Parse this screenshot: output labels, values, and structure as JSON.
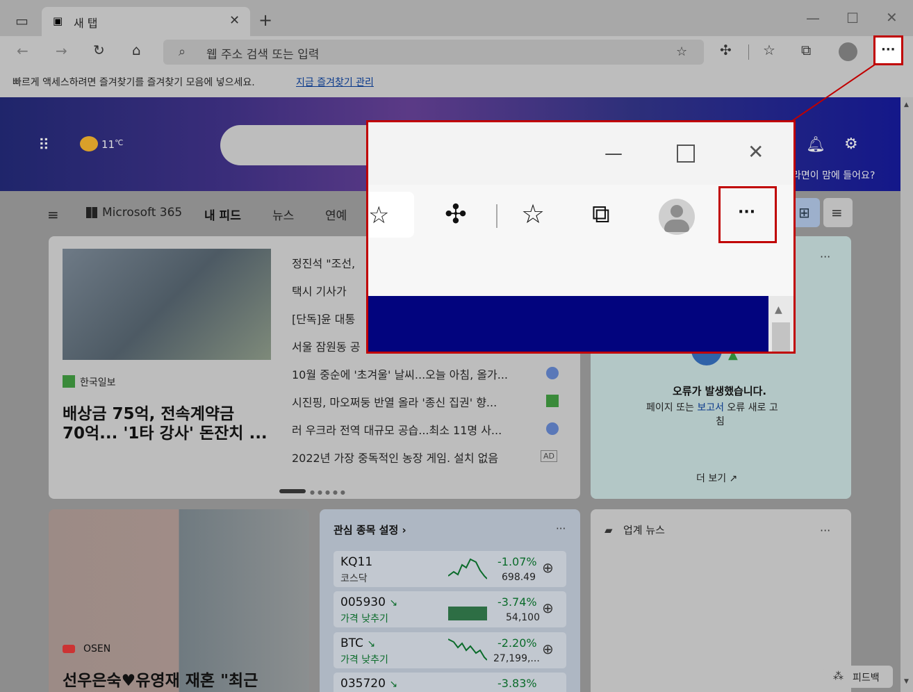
{
  "tab": {
    "title": "새 탭"
  },
  "address": {
    "placeholder": "웹 주소 검색 또는 입력"
  },
  "favbar": {
    "text": "빠르게 액세스하려면 즐겨찾기를 즐겨찾기 모음에 넣으세요.",
    "link": "지금 즐겨찾기 관리"
  },
  "weather": {
    "temp": "11",
    "unit": "℃"
  },
  "hero": {
    "question": "라면이 맘에 들어요?"
  },
  "nav": {
    "ms365": "Microsoft 365",
    "feed": "내 피드",
    "news": "뉴스",
    "ent": "연예"
  },
  "headlines": [
    "정진석 \"조선,",
    "택시 기사가 ",
    "[단독]윤 대통",
    "서울 잠원동 공",
    "10월 중순에 '초겨울' 날씨...오늘 아침, 올가...",
    "시진핑, 마오쩌둥 반열 올라 '종신 집권' 향...",
    "러 우크라 전역 대규모 공습...최소 11명 사...",
    "2022년 가장 중독적인 농장 게임. 설치 없음"
  ],
  "ad": "AD",
  "main_story": {
    "source": "한국일보",
    "title1": "배상금 75억, 전속계약금",
    "title2": "70억... '1타 강사' 돈잔치 ..."
  },
  "error_card": {
    "title": "오류가 발생했습니다.",
    "line1": "페이지 또는 ",
    "link": "보고서",
    "line1b": " 오류 새로 고",
    "line2": "침",
    "more": "더 보기"
  },
  "photo_story": {
    "source": "OSEN",
    "title": "선우은숙♥유영재 재혼 \"최근"
  },
  "stocks": {
    "header": "관심 종목 설정",
    "items": [
      {
        "sym": "KQ11",
        "sub": "코스닥",
        "change": "-1.07%",
        "price": "698.49"
      },
      {
        "sym": "005930",
        "sub": "가격 낮추기",
        "change": "-3.74%",
        "price": "54,100"
      },
      {
        "sym": "BTC",
        "sub": "가격 낮추기",
        "change": "-2.20%",
        "price": "27,199,..."
      },
      {
        "sym": "035720",
        "sub": "",
        "change": "-3.83%",
        "price": ""
      }
    ]
  },
  "industry": {
    "title": "업계 뉴스"
  },
  "feedback": {
    "label": "피드백"
  },
  "colors": {
    "accent": "#c00000",
    "link": "#0b3a8c",
    "positive_down": "#0a6b2a"
  }
}
